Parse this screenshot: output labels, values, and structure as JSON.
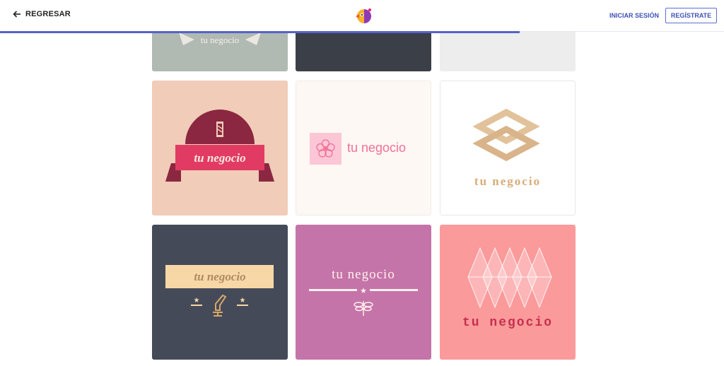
{
  "header": {
    "back_label": "REGRESAR",
    "signin_label": "INICIAR SESIÓN",
    "register_label": "REGÍSTRATE",
    "progress": 0.718
  },
  "colors": {
    "accent": "#3f51b5",
    "progress": "#5663c7"
  },
  "logos": [
    {
      "text": "tu negocio",
      "bg": "#b1b9b3"
    },
    {
      "text": "",
      "bg": "#3b3f48"
    },
    {
      "text": "",
      "bg": "#ededed"
    },
    {
      "text": "tu negocio",
      "bg": "#f1ccb8"
    },
    {
      "text": "tu negocio",
      "bg": "#fdf8f3"
    },
    {
      "text": "tu negocio",
      "bg": "#ffffff"
    },
    {
      "text": "tu negocio",
      "bg": "#454a59"
    },
    {
      "text": "tu negocio",
      "bg": "#c574a9"
    },
    {
      "text": "tu negocio",
      "bg": "#fb9a9b"
    }
  ]
}
